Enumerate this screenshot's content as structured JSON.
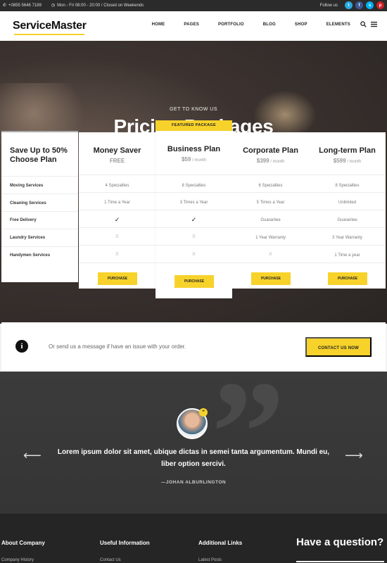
{
  "topbar": {
    "phone": "+0855 5646 7189",
    "hours": "Mon - Fri 08:00 - 20:00 / Closed on Weekends",
    "follow_label": "Follow us",
    "social": [
      {
        "name": "twitter-icon",
        "glyph": "t",
        "color": "#29a9e1"
      },
      {
        "name": "facebook-icon",
        "glyph": "f",
        "color": "#3b5998"
      },
      {
        "name": "skype-icon",
        "glyph": "s",
        "color": "#00aff0"
      },
      {
        "name": "pinterest-icon",
        "glyph": "p",
        "color": "#cb2027"
      }
    ]
  },
  "nav": {
    "logo": "ServiceMaster",
    "menu": [
      "HOME",
      "PAGES",
      "PORTFOLIO",
      "BLOG",
      "SHOP",
      "ELEMENTS"
    ]
  },
  "hero": {
    "pre_title": "GET TO KNOW US",
    "title": "Pricing Packages"
  },
  "pricing": {
    "featured_label": "FEATURED PACKAGE",
    "headline": "Save Up to 50% Choose Plan",
    "features": [
      "Moving Services",
      "Cleaning Services",
      "Free Delivery",
      "Laundry Services",
      "Handymen Services"
    ],
    "plans": [
      {
        "name": "Money Saver",
        "price": "FREE",
        "per": "",
        "cells": [
          "4 Specialties",
          "1 Time a Year",
          "✓",
          "X",
          "X"
        ],
        "button": "PURCHASE"
      },
      {
        "name": "Business Plan",
        "price": "$59",
        "per": " / month",
        "cells": [
          "8 Specialties",
          "3 Times a Year",
          "✓",
          "X",
          "X"
        ],
        "button": "PURCHASE"
      },
      {
        "name": "Corporate Plan",
        "price": "$399",
        "per": " / month",
        "cells": [
          "6 Specialties",
          "5 Times a Year",
          "Guarantee",
          "1 Year Warranty",
          "X"
        ],
        "button": "PURCHASE"
      },
      {
        "name": "Long-term Plan",
        "price": "$599",
        "per": " / month",
        "cells": [
          "8 Specialties",
          "Unlimited",
          "Guarantee",
          "3 Year Warranty",
          "1 Time a year"
        ],
        "button": "PURCHASE"
      }
    ]
  },
  "contact": {
    "text": "Or send us a message if have an issue with your order.",
    "button": "CONTACT US NOW"
  },
  "testimonial": {
    "quote": "Lorem ipsum dolor sit amet, ubique dictas in semei tanta argumentum. Mundi eu, liber option sercivi.",
    "author": "—JOHAN ALBURLINGTON"
  },
  "footer": {
    "columns": [
      {
        "heading": "About Company",
        "first_link": "Company History"
      },
      {
        "heading": "Useful Information",
        "first_link": "Contact Us"
      },
      {
        "heading": "Additional Links",
        "first_link": "Latest Posts"
      }
    ],
    "question": "Have a question?"
  },
  "colors": {
    "accent": "#f7d22b",
    "dark": "#2b2b2b"
  }
}
